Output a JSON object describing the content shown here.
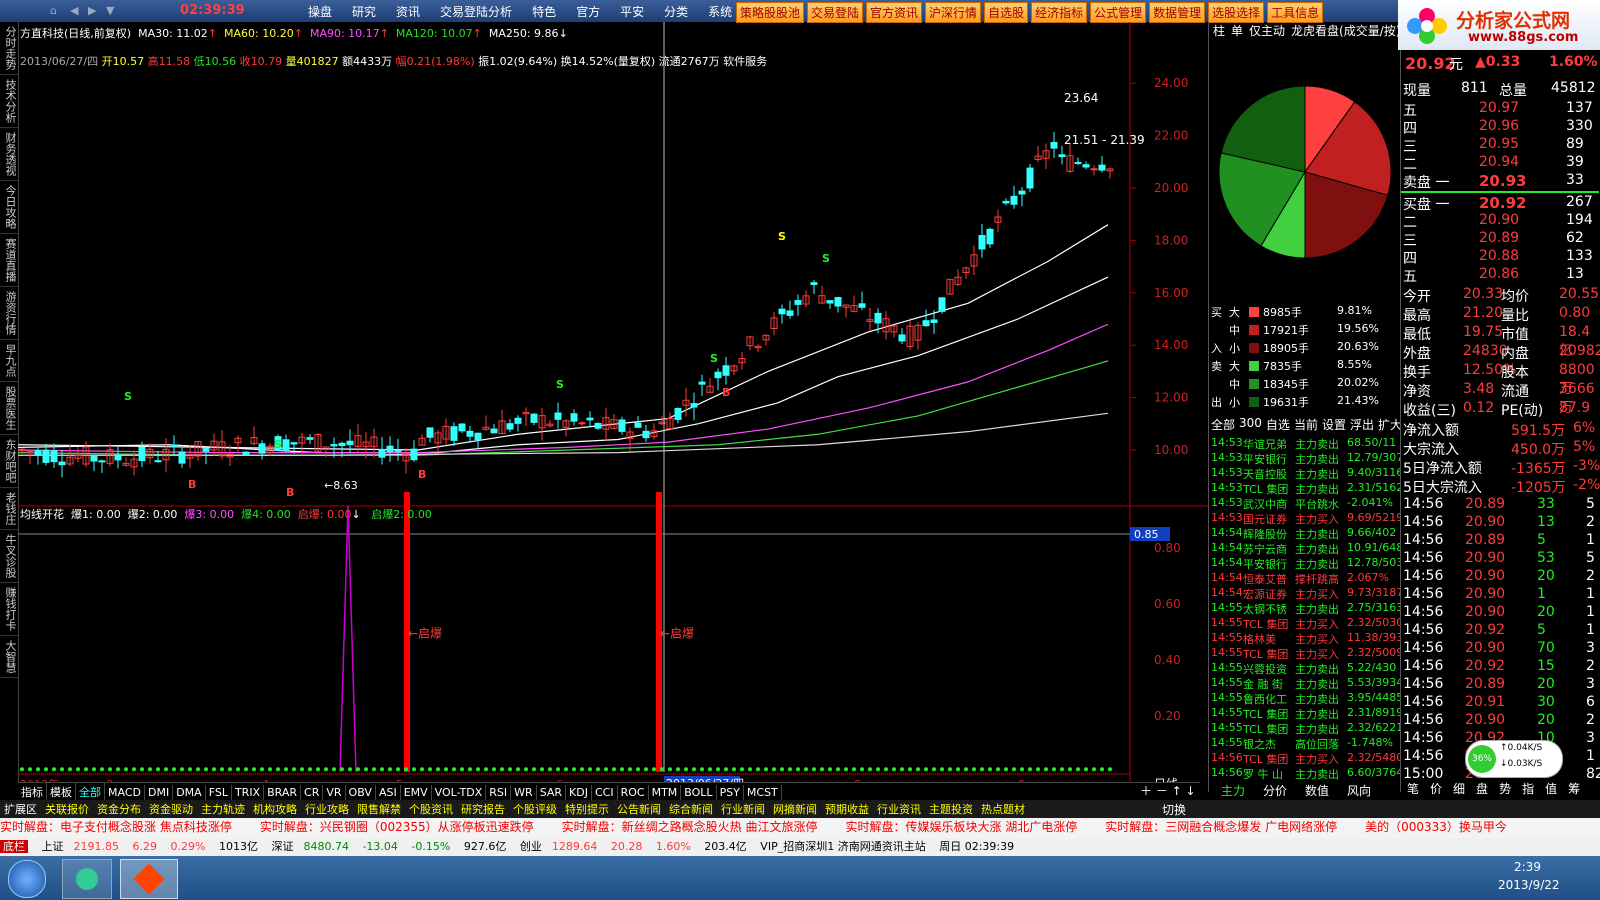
{
  "app": {
    "clock": "02:39:39",
    "menu": [
      "操盘",
      "研究",
      "资讯",
      "交易登陆分析",
      "特色",
      "官方",
      "平安",
      "分类",
      "系统"
    ],
    "quick_buttons": [
      "策略股股池",
      "交易登陆",
      "官方资讯",
      "沪深行情",
      "自选股",
      "经济指标",
      "公式管理",
      "数据管理",
      "选股选择",
      "工具信息"
    ],
    "logo_title": "分析家公式网",
    "logo_url": "www.88gs.com"
  },
  "left_tabs": [
    "分时走势",
    "技术分析",
    "财务透视",
    "今日攻略",
    "赛道直播",
    "游资行情",
    "早九点",
    "股票医生",
    "东财吧吧",
    "老钱庄",
    "牛叉诊股",
    "赚钱打卡",
    "大智慧"
  ],
  "chart_header": {
    "title": "方直科技(日线,前复权)",
    "ma30": "MA30: 11.02",
    "ma60": "MA60: 10.20",
    "ma90": "MA90: 10.17",
    "ma120": "MA120: 10.07",
    "ma250": "MA250: 9.86",
    "info_date": "2013/06/27/四",
    "info_open": "开10.57",
    "info_high": "高11.58",
    "info_low": "低10.56",
    "info_close": "收10.79",
    "info_vol": "量401827",
    "info_amt": "额4433万",
    "info_pct": "幅0.21(1.98%)",
    "info_rest": "振1.02(9.64%) 换14.52%(量复权) 流通2767万 软件服务",
    "price_ticks": [
      "24.00",
      "22.00",
      "20.00",
      "18.00",
      "16.00",
      "14.00",
      "12.00",
      "10.00"
    ],
    "hi_label": "23.64",
    "range_label": "21.51 - 21.39",
    "lo_label": "8.63"
  },
  "indicator": {
    "name": "均线开花",
    "b1": "爆1: 0.00",
    "b2": "爆2: 0.00",
    "b3": "爆3: 0.00",
    "b4": "爆4: 0.00",
    "qb": "启爆: 0.00",
    "qb2": "启爆2: 0.00",
    "ticks": [
      "0.85",
      "0.80",
      "0.60",
      "0.40",
      "0.20"
    ],
    "label_qb": "启爆"
  },
  "time_axis": {
    "year": "2013年",
    "months": [
      "3",
      "4",
      "5",
      "6",
      "8",
      "9"
    ],
    "cursor_date": "2013/06/27/四",
    "period": "日线"
  },
  "indicator_tabs": [
    "指标",
    "模板",
    "全部",
    "MACD",
    "DMI",
    "DMA",
    "FSL",
    "TRIX",
    "BRAR",
    "CR",
    "VR",
    "OBV",
    "ASI",
    "EMV",
    "VOL-TDX",
    "RSI",
    "WR",
    "SAR",
    "KDJ",
    "CCI",
    "ROC",
    "MTM",
    "BOLL",
    "PSY",
    "MCST"
  ],
  "feature_tabs": [
    "扩展区",
    "关联报价",
    "资金分布",
    "资金驱动",
    "主力轨迹",
    "机构攻略",
    "行业攻略",
    "限售解禁",
    "个股资讯",
    "研究报告",
    "个股评级",
    "特别提示",
    "公告新闻",
    "综合新闻",
    "行业新闻",
    "网摘新闻",
    "预期收益",
    "行业资讯",
    "主题投资",
    "热点题材"
  ],
  "mid": {
    "tabs": [
      "柱",
      "单",
      "仅主动",
      "龙虎看盘(成交量/按)"
    ],
    "flows": [
      {
        "side": "买",
        "size": "大",
        "qty": "8985手",
        "pct": "9.81%"
      },
      {
        "side": "",
        "size": "中",
        "qty": "17921手",
        "pct": "19.56%"
      },
      {
        "side": "入",
        "size": "小",
        "qty": "18905手",
        "pct": "20.63%"
      },
      {
        "side": "卖",
        "size": "大",
        "qty": "7835手",
        "pct": "8.55%"
      },
      {
        "side": "",
        "size": "中",
        "qty": "18345手",
        "pct": "20.02%"
      },
      {
        "side": "出",
        "size": "小",
        "qty": "19631手",
        "pct": "21.43%"
      }
    ],
    "filter": [
      "全部",
      "300",
      "自选",
      "当前",
      "设置",
      "浮出",
      "扩大"
    ],
    "news": [
      {
        "t": "14:53",
        "n": "华谊兄弟",
        "a": "主力卖出",
        "v": "68.50/11"
      },
      {
        "t": "14:53",
        "n": "平安银行",
        "a": "主力卖出",
        "v": "12.79/307"
      },
      {
        "t": "14:53",
        "n": "天音控股",
        "a": "主力卖出",
        "v": "9.40/3116"
      },
      {
        "t": "14:53",
        "n": "TCL 集团",
        "a": "主力卖出",
        "v": "2.31/5162"
      },
      {
        "t": "14:53",
        "n": "武汉中商",
        "a": "平台跳水",
        "v": "-2.041%"
      },
      {
        "t": "14:53",
        "n": "国元证券",
        "a": "主力买入",
        "v": "9.69/5219"
      },
      {
        "t": "14:54",
        "n": "辉隆股份",
        "a": "主力卖出",
        "v": "9.66/402"
      },
      {
        "t": "14:54",
        "n": "苏宁云商",
        "a": "主力卖出",
        "v": "10.91/648"
      },
      {
        "t": "14:54",
        "n": "平安银行",
        "a": "主力卖出",
        "v": "12.78/503"
      },
      {
        "t": "14:54",
        "n": "恒泰艾普",
        "a": "撑杆跳高",
        "v": "2.067%"
      },
      {
        "t": "14:54",
        "n": "宏源证券",
        "a": "主力买入",
        "v": "9.73/3187"
      },
      {
        "t": "14:55",
        "n": "太钢不锈",
        "a": "主力卖出",
        "v": "2.75/3163"
      },
      {
        "t": "14:55",
        "n": "TCL 集团",
        "a": "主力买入",
        "v": "2.32/5030"
      },
      {
        "t": "14:55",
        "n": "格林美",
        "a": "主力买入",
        "v": "11.38/393"
      },
      {
        "t": "14:55",
        "n": "TCL 集团",
        "a": "主力买入",
        "v": "2.32/5009"
      },
      {
        "t": "14:55",
        "n": "兴蓉投资",
        "a": "主力卖出",
        "v": "5.22/430"
      },
      {
        "t": "14:55",
        "n": "金 融 街",
        "a": "主力卖出",
        "v": "5.53/3934"
      },
      {
        "t": "14:55",
        "n": "鲁西化工",
        "a": "主力卖出",
        "v": "3.95/4485"
      },
      {
        "t": "14:55",
        "n": "TCL 集团",
        "a": "主力卖出",
        "v": "2.31/8919"
      },
      {
        "t": "14:55",
        "n": "TCL 集团",
        "a": "主力卖出",
        "v": "2.32/6221"
      },
      {
        "t": "14:55",
        "n": "银之杰",
        "a": "高位回落",
        "v": "-1.748%"
      },
      {
        "t": "14:56",
        "n": "TCL 集团",
        "a": "主力买入",
        "v": "2.32/5480"
      },
      {
        "t": "14:56",
        "n": "罗 牛 山",
        "a": "主力卖出",
        "v": "6.60/3764"
      }
    ],
    "bottom_tabs": [
      "主力",
      "分价",
      "数值",
      "风向"
    ],
    "switch_label": "切换"
  },
  "quote": {
    "price": "20.92",
    "unit": "元",
    "change": "▲0.33",
    "pct": "1.60%",
    "now_qty_label": "现量",
    "now_qty": "811",
    "total_label": "总量",
    "total": "45812",
    "sells": [
      {
        "l": "五",
        "p": "20.97",
        "v": "137"
      },
      {
        "l": "四",
        "p": "20.96",
        "v": "330"
      },
      {
        "l": "三",
        "p": "20.95",
        "v": "89"
      },
      {
        "l": "二",
        "p": "20.94",
        "v": "39"
      },
      {
        "l": "卖盘 一",
        "p": "20.93",
        "v": "33"
      }
    ],
    "buys": [
      {
        "l": "买盘 一",
        "p": "20.92",
        "v": "267"
      },
      {
        "l": "二",
        "p": "20.90",
        "v": "194"
      },
      {
        "l": "三",
        "p": "20.89",
        "v": "62"
      },
      {
        "l": "四",
        "p": "20.88",
        "v": "133"
      },
      {
        "l": "五",
        "p": "20.86",
        "v": "13"
      }
    ],
    "stats": [
      {
        "a": "今开",
        "av": "20.33",
        "b": "均价",
        "bv": "20.55"
      },
      {
        "a": "最高",
        "av": "21.20",
        "b": "量比",
        "bv": "0.80"
      },
      {
        "a": "最低",
        "av": "19.75",
        "b": "市值",
        "bv": "18.4亿"
      },
      {
        "a": "外盘",
        "av": "24830",
        "b": "内盘",
        "bv": "20982"
      },
      {
        "a": "换手",
        "av": "12.50%",
        "b": "股本",
        "bv": "8800万"
      },
      {
        "a": "净资",
        "av": "3.48",
        "b": "流通",
        "bv": "3666万"
      },
      {
        "a": "收益(三)",
        "av": "0.12",
        "b": "PE(动)",
        "bv": "87.9"
      }
    ],
    "flow": [
      {
        "k": "净流入额",
        "v": "591.5万",
        "p": "6%"
      },
      {
        "k": "大宗流入",
        "v": "450.0万",
        "p": "5%"
      },
      {
        "k": "5日净流入额",
        "v": "-1365万",
        "p": "-3%"
      },
      {
        "k": "5日大宗流入",
        "v": "-1205万",
        "p": "-2%"
      }
    ],
    "ticks": [
      {
        "t": "14:56",
        "p": "20.89",
        "v": "33",
        "n": "5"
      },
      {
        "t": "14:56",
        "p": "20.90",
        "v": "13",
        "n": "2"
      },
      {
        "t": "14:56",
        "p": "20.89",
        "v": "5",
        "n": "1"
      },
      {
        "t": "14:56",
        "p": "20.90",
        "v": "53",
        "n": "5"
      },
      {
        "t": "14:56",
        "p": "20.90",
        "v": "20",
        "n": "2"
      },
      {
        "t": "14:56",
        "p": "20.90",
        "v": "1",
        "n": "1"
      },
      {
        "t": "14:56",
        "p": "20.90",
        "v": "20",
        "n": "1"
      },
      {
        "t": "14:56",
        "p": "20.92",
        "v": "5",
        "n": "1"
      },
      {
        "t": "14:56",
        "p": "20.90",
        "v": "70",
        "n": "3"
      },
      {
        "t": "14:56",
        "p": "20.92",
        "v": "15",
        "n": "2"
      },
      {
        "t": "14:56",
        "p": "20.89",
        "v": "20",
        "n": "3"
      },
      {
        "t": "14:56",
        "p": "20.91",
        "v": "30",
        "n": "6"
      },
      {
        "t": "14:56",
        "p": "20.90",
        "v": "20",
        "n": "2"
      },
      {
        "t": "14:56",
        "p": "20.92",
        "v": "10",
        "n": "3"
      },
      {
        "t": "14:56",
        "p": "20.92",
        "v": "",
        "n": "1"
      },
      {
        "t": "15:00",
        "p": "20.92",
        "v": "",
        "n": "82"
      }
    ],
    "net_gauge": "36%",
    "net_up": "0.04K/S",
    "net_down": "0.03K/S",
    "bottom_tabs": [
      "笔",
      "价",
      "细",
      "盘",
      "势",
      "指",
      "值",
      "筹"
    ]
  },
  "ticker": [
    "实时解盘：电子支付概念股涨  焦点科技涨停",
    "实时解盘：兴民钢圈（002355）从涨停板迅速跌停",
    "实时解盘：新丝绸之路概念股火热  曲江文旅涨停",
    "实时解盘：传媒娱乐板块大涨  湖北广电涨停",
    "实时解盘：三网融合概念爆发  广电网络涨停",
    "美的（000333）换马甲今"
  ],
  "status": {
    "sh_label": "上证",
    "sh": "2191.85",
    "sh_chg": "6.29",
    "sh_pct": "0.29%",
    "sh_amt": "1013亿",
    "sz_label": "深证",
    "sz": "8480.74",
    "sz_chg": "-13.04",
    "sz_pct": "-0.15%",
    "sz_amt": "927.6亿",
    "cy_label": "创业",
    "cy": "1289.64",
    "cy_chg": "20.28",
    "cy_pct": "1.60%",
    "cy_amt": "203.4亿",
    "conn": "VIP_招商深圳1  济南网通资讯主站",
    "day": "周日  02:39:39",
    "win_time": "2:39",
    "win_date": "2013/9/22"
  },
  "colors": {
    "up": "#ff3b3b",
    "down": "#28e0e0",
    "bg": "#000000",
    "accent": "#ffff30"
  }
}
